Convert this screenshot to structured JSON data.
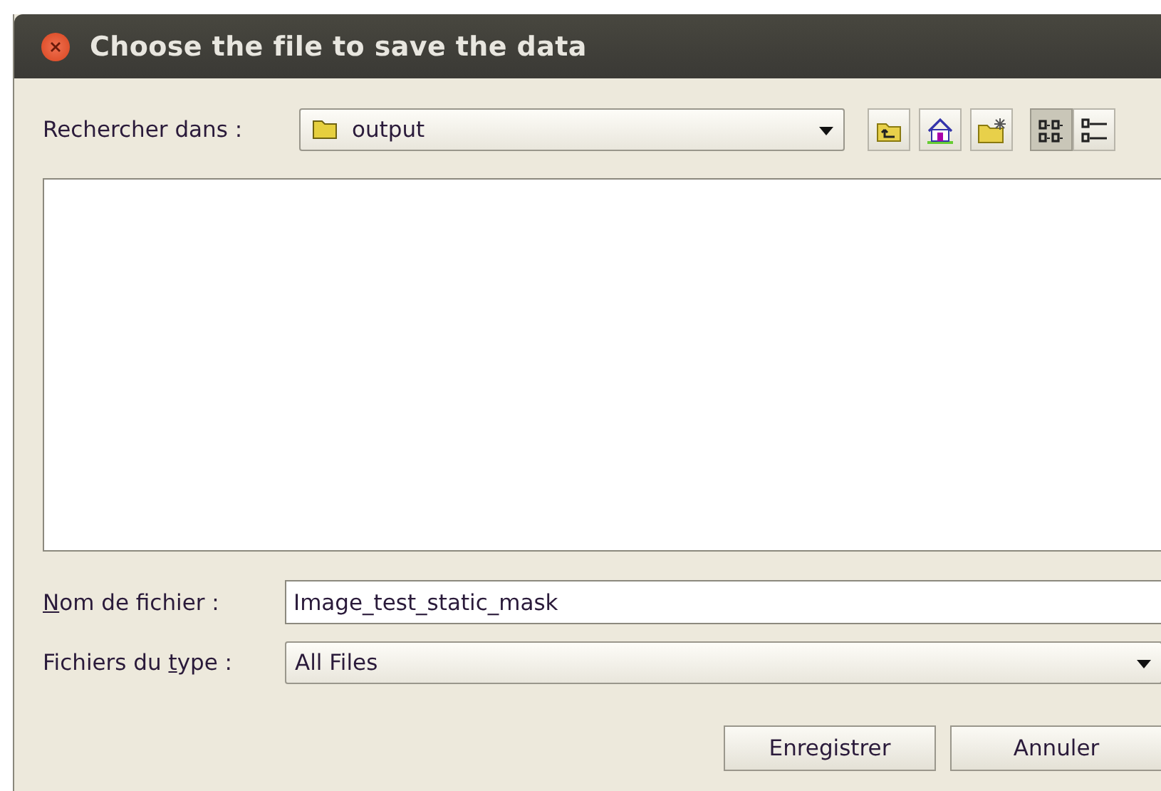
{
  "window": {
    "title": "Choose the file to save the data"
  },
  "look_in": {
    "label": "Rechercher dans :",
    "value": "output"
  },
  "nav_buttons": [
    {
      "kind": "up-folder"
    },
    {
      "kind": "home"
    },
    {
      "kind": "new-folder"
    }
  ],
  "view_buttons": [
    {
      "kind": "list",
      "selected": true
    },
    {
      "kind": "details",
      "selected": false
    }
  ],
  "file_name": {
    "label": {
      "key": "N",
      "after": "om de fichier :"
    },
    "value": "Image_test_static_mask"
  },
  "file_type": {
    "label": {
      "before": "Fichiers du ",
      "key": "t",
      "after": "ype :"
    },
    "value": "All Files"
  },
  "buttons": [
    {
      "label": "Enregistrer"
    },
    {
      "label": "Annuler"
    }
  ]
}
